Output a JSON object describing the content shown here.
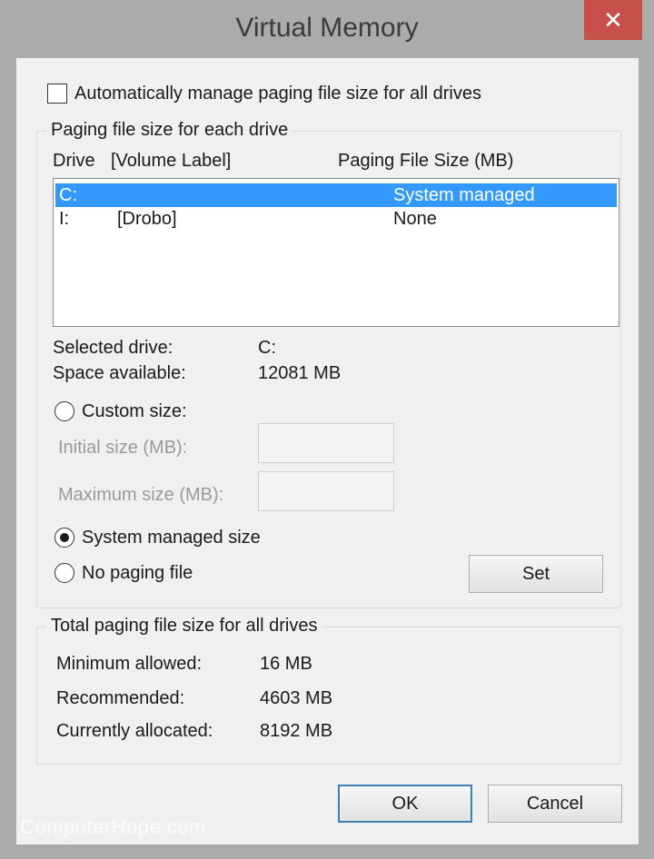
{
  "window": {
    "title": "Virtual Memory",
    "close_glyph": "✕"
  },
  "auto_manage": {
    "label": "Automatically manage paging file size for all drives",
    "checked": false
  },
  "per_drive": {
    "legend": "Paging file size for each drive",
    "header_drive": "Drive",
    "header_volume": "[Volume Label]",
    "header_size": "Paging File Size (MB)",
    "rows": [
      {
        "drive": "C:",
        "volume": "",
        "size": "System managed",
        "selected": true
      },
      {
        "drive": "I:",
        "volume": "[Drobo]",
        "size": "None",
        "selected": false
      }
    ],
    "selected_drive_label": "Selected drive:",
    "selected_drive_value": "C:",
    "space_label": "Space available:",
    "space_value": "12081 MB",
    "custom_label": "Custom size:",
    "initial_label": "Initial size (MB):",
    "initial_value": "",
    "maximum_label": "Maximum size (MB):",
    "maximum_value": "",
    "system_label": "System managed size",
    "nopaging_label": "No paging file",
    "selected_option": "system",
    "set_label": "Set"
  },
  "totals": {
    "legend": "Total paging file size for all drives",
    "min_label": "Minimum allowed:",
    "min_value": "16 MB",
    "rec_label": "Recommended:",
    "rec_value": "4603 MB",
    "cur_label": "Currently allocated:",
    "cur_value": "8192 MB"
  },
  "buttons": {
    "ok": "OK",
    "cancel": "Cancel"
  },
  "watermark": "ComputerHope.com",
  "colors": {
    "selection": "#3399ff",
    "close": "#c7504b",
    "default_border": "#3c7fb1"
  }
}
